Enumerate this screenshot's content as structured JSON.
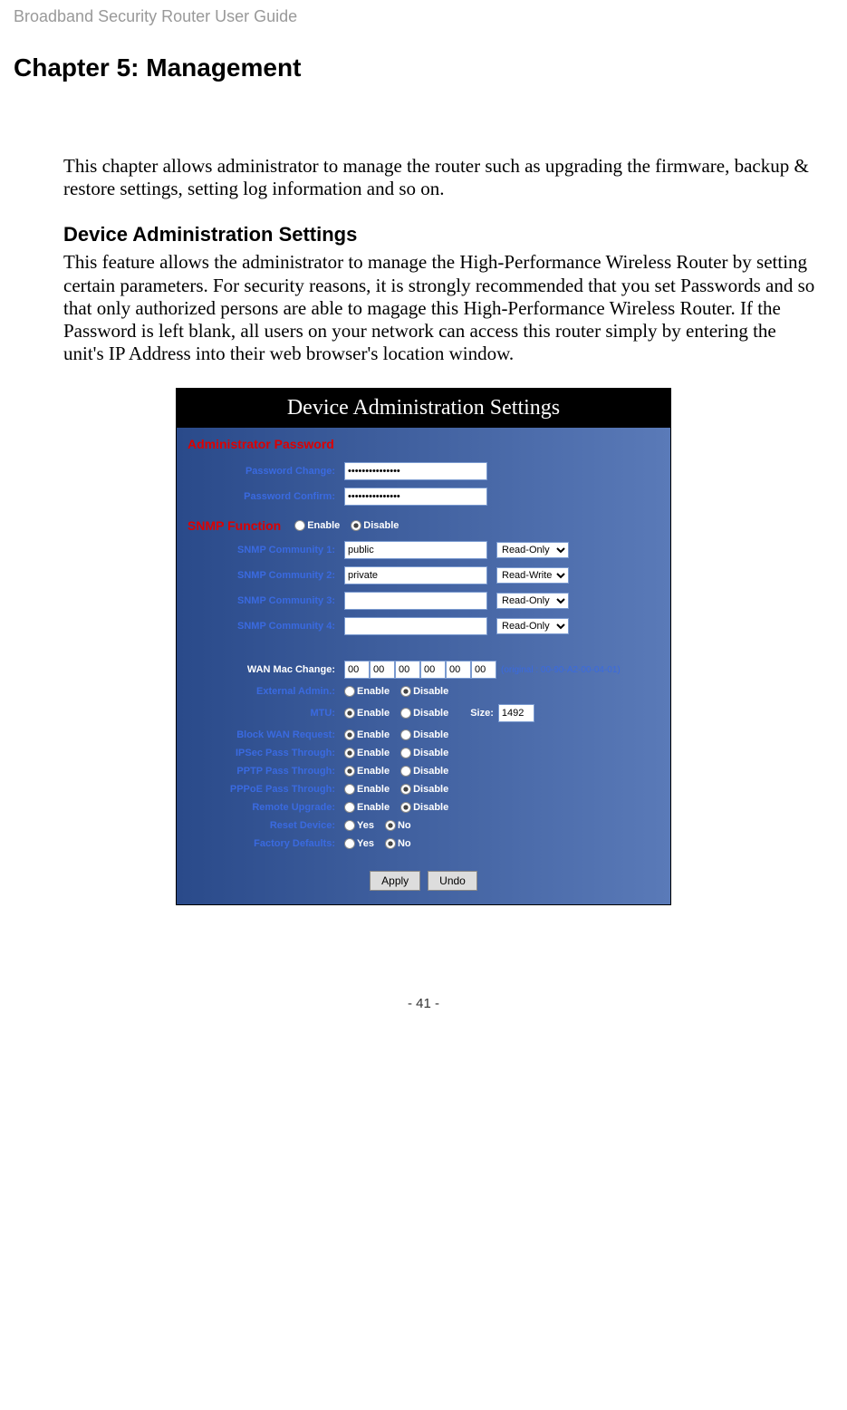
{
  "header": "Broadband Security Router User Guide",
  "chapter": "Chapter 5: Management",
  "paragraph1": "This chapter allows administrator to manage the router such as upgrading the firmware, backup & restore settings, setting log information and so on.",
  "section1_title": "Device Administration Settings",
  "paragraph2": "This feature allows the administrator to manage the High-Performance Wireless Router by setting certain parameters. For security reasons, it is strongly recommended that you set Passwords and so that only authorized persons are able to magage this High-Performance Wireless Router. If the Password is left blank, all users on your network can access this router simply by entering the unit's IP Address into their web browser's location window.",
  "screenshot": {
    "title": "Device Administration Settings",
    "admin_password_section": "Administrator Password",
    "password_change_label": "Password Change:",
    "password_change_value": "•••••••••••••••",
    "password_confirm_label": "Password Confirm:",
    "password_confirm_value": "•••••••••••••••",
    "snmp_function_label": "SNMP Function",
    "snmp_function_selected": "Disable",
    "enable_label": "Enable",
    "disable_label": "Disable",
    "snmp1_label": "SNMP Community 1:",
    "snmp1_value": "public",
    "snmp1_perm": "Read-Only",
    "snmp2_label": "SNMP Community 2:",
    "snmp2_value": "private",
    "snmp2_perm": "Read-Write",
    "snmp3_label": "SNMP Community 3:",
    "snmp3_value": "",
    "snmp3_perm": "Read-Only",
    "snmp4_label": "SNMP Community 4:",
    "snmp4_value": "",
    "snmp4_perm": "Read-Only",
    "wan_mac_label": "WAN Mac Change:",
    "wan_mac_values": [
      "00",
      "00",
      "00",
      "00",
      "00",
      "00"
    ],
    "wan_mac_original": "(original : 00-90-A2-00-04-01)",
    "external_admin_label": "External Admin.:",
    "external_admin_selected": "Disable",
    "mtu_label": "MTU:",
    "mtu_selected": "Enable",
    "mtu_size_label": "Size:",
    "mtu_size_value": "1492",
    "block_wan_label": "Block WAN Request:",
    "block_wan_selected": "Enable",
    "ipsec_label": "IPSec Pass Through:",
    "ipsec_selected": "Enable",
    "pptp_label": "PPTP Pass Through:",
    "pptp_selected": "Enable",
    "pppoe_label": "PPPoE Pass Through:",
    "pppoe_selected": "Disable",
    "remote_label": "Remote Upgrade:",
    "remote_selected": "Disable",
    "reset_label": "Reset Device:",
    "reset_selected": "No",
    "yes_label": "Yes",
    "no_label": "No",
    "factory_label": "Factory Defaults:",
    "factory_selected": "No",
    "apply_button": "Apply",
    "undo_button": "Undo"
  },
  "footer": "- 41 -"
}
